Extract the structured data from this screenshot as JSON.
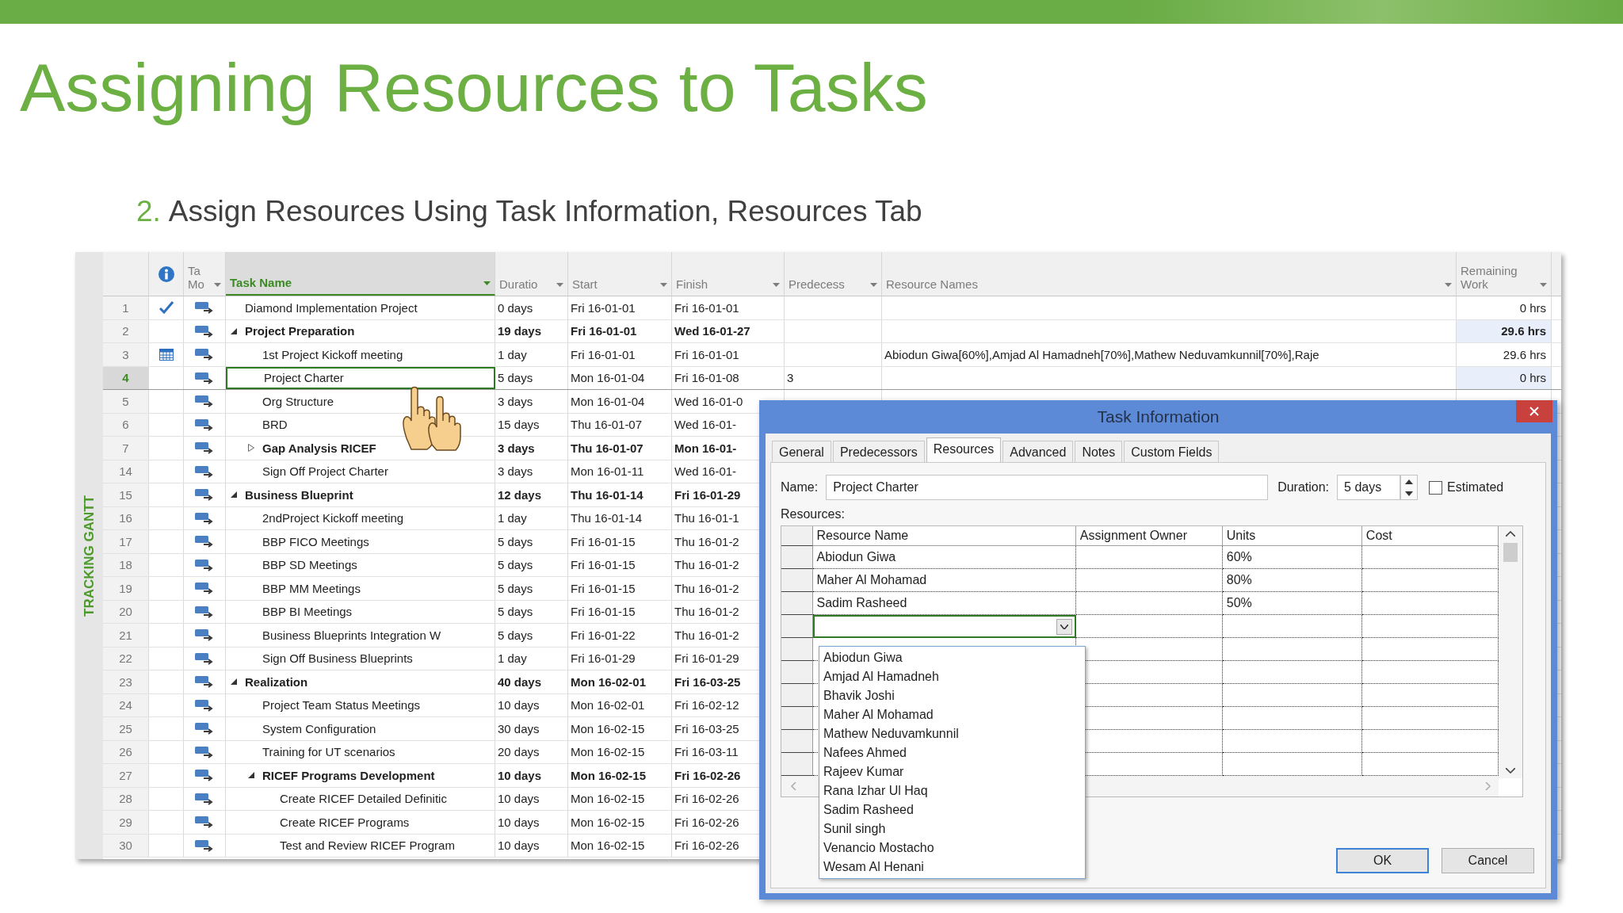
{
  "slide": {
    "title": "Assigning Resources to Tasks",
    "step_number": "2.",
    "subtitle": "Assign Resources Using Task Information, Resources Tab",
    "side_label": "TRACKING GANTT"
  },
  "table": {
    "columns": [
      {
        "kind": "info",
        "selected": false
      },
      {
        "kind": "text",
        "label": "Ta Mo",
        "selected": false
      },
      {
        "kind": "text",
        "label": "Task Name",
        "selected": true
      },
      {
        "kind": "text",
        "label": "Duratio",
        "selected": false
      },
      {
        "kind": "text",
        "label": "Start",
        "selected": false
      },
      {
        "kind": "text",
        "label": "Finish",
        "selected": false
      },
      {
        "kind": "text",
        "label": "Predecess",
        "selected": false
      },
      {
        "kind": "text",
        "label": "Resource Names",
        "selected": false
      },
      {
        "kind": "text",
        "label": "Remaining Work",
        "selected": false
      }
    ],
    "rows": [
      {
        "id": "1",
        "indicator": {
          "kind": "checkmark"
        },
        "name": "Diamond Implementation Project",
        "summary": false,
        "selected": false,
        "duration": "0 days",
        "start": "Fri 16-01-01",
        "finish": "Fri 16-01-01",
        "remaining_work": "0 hrs"
      },
      {
        "id": "2",
        "name": "Project Preparation",
        "summary": true,
        "expanded": true,
        "selected": false,
        "duration": "19 days",
        "start": "Fri 16-01-01",
        "finish": "Wed 16-01-27",
        "remaining_work": "29.6 hrs",
        "children": [
          {
            "id": "3",
            "indicator": {
              "kind": "calendar"
            },
            "name": "1st Project Kickoff meeting",
            "summary": false,
            "selected": false,
            "duration": "1 day",
            "start": "Fri 16-01-01",
            "finish": "Fri 16-01-01",
            "resource_names": "Abiodun Giwa[60%],Amjad Al Hamadneh[70%],Mathew Neduvamkunnil[70%],Raje",
            "remaining_work": "29.6 hrs"
          },
          {
            "id": "4",
            "name": "Project Charter",
            "summary": false,
            "selected": true,
            "duration": "5 days",
            "start": "Mon 16-01-04",
            "finish": "Fri 16-01-08",
            "predecessors": "3",
            "remaining_work": "0 hrs"
          },
          {
            "id": "5",
            "name": "Org Structure",
            "summary": false,
            "selected": false,
            "duration": "3 days",
            "start": "Mon 16-01-04",
            "finish": "Wed 16-01-0"
          },
          {
            "id": "6",
            "name": "BRD",
            "summary": false,
            "selected": false,
            "duration": "15 days",
            "start": "Thu 16-01-07",
            "finish": "Wed 16-01-"
          },
          {
            "id": "7",
            "name": "Gap Analysis RICEF",
            "summary": true,
            "expanded": false,
            "selected": false,
            "duration": "3 days",
            "start": "Thu 16-01-07",
            "finish": "Mon 16-01-"
          },
          {
            "id": "14",
            "name": "Sign Off  Project Charter",
            "summary": false,
            "selected": false,
            "duration": "3 days",
            "start": "Mon 16-01-11",
            "finish": "Wed 16-01-"
          }
        ]
      },
      {
        "id": "15",
        "name": "Business Blueprint",
        "summary": true,
        "expanded": true,
        "selected": false,
        "duration": "12 days",
        "start": "Thu 16-01-14",
        "finish": "Fri 16-01-29",
        "children": [
          {
            "id": "16",
            "name": "2ndProject Kickoff meeting",
            "summary": false,
            "selected": false,
            "duration": "1 day",
            "start": "Thu 16-01-14",
            "finish": "Thu 16-01-1"
          },
          {
            "id": "17",
            "name": "BBP FICO Meetings",
            "summary": false,
            "selected": false,
            "duration": "5 days",
            "start": "Fri 16-01-15",
            "finish": "Thu 16-01-2"
          },
          {
            "id": "18",
            "name": "BBP SD Meetings",
            "summary": false,
            "selected": false,
            "duration": "5 days",
            "start": "Fri 16-01-15",
            "finish": "Thu 16-01-2"
          },
          {
            "id": "19",
            "name": "BBP MM Meetings",
            "summary": false,
            "selected": false,
            "duration": "5 days",
            "start": "Fri 16-01-15",
            "finish": "Thu 16-01-2"
          },
          {
            "id": "20",
            "name": "BBP BI Meetings",
            "summary": false,
            "selected": false,
            "duration": "5 days",
            "start": "Fri 16-01-15",
            "finish": "Thu 16-01-2"
          },
          {
            "id": "21",
            "name": "Business Blueprints Integration W",
            "summary": false,
            "selected": false,
            "duration": "5 days",
            "start": "Fri 16-01-22",
            "finish": "Thu 16-01-2"
          },
          {
            "id": "22",
            "name": "Sign Off  Business Blueprints",
            "summary": false,
            "selected": false,
            "duration": "1 day",
            "start": "Fri 16-01-29",
            "finish": "Fri 16-01-29"
          }
        ]
      },
      {
        "id": "23",
        "name": "Realization",
        "summary": true,
        "expanded": true,
        "selected": false,
        "duration": "40 days",
        "start": "Mon 16-02-01",
        "finish": "Fri 16-03-25",
        "children": [
          {
            "id": "24",
            "name": "Project Team Status Meetings",
            "summary": false,
            "selected": false,
            "duration": "10 days",
            "start": "Mon 16-02-01",
            "finish": "Fri 16-02-12"
          },
          {
            "id": "25",
            "name": "System Configuration",
            "summary": false,
            "selected": false,
            "duration": "30 days",
            "start": "Mon 16-02-15",
            "finish": "Fri 16-03-25"
          },
          {
            "id": "26",
            "name": "Training for UT scenarios",
            "summary": false,
            "selected": false,
            "duration": "20 days",
            "start": "Mon 16-02-15",
            "finish": "Fri 16-03-11"
          },
          {
            "id": "27",
            "name": "RICEF Programs Development",
            "summary": true,
            "expanded": true,
            "selected": false,
            "duration": "10 days",
            "start": "Mon 16-02-15",
            "finish": "Fri 16-02-26",
            "children": [
              {
                "id": "28",
                "name": "Create RICEF Detailed Definitic",
                "summary": false,
                "selected": false,
                "duration": "10 days",
                "start": "Mon 16-02-15",
                "finish": "Fri 16-02-26"
              },
              {
                "id": "29",
                "name": "Create RICEF Programs",
                "summary": false,
                "selected": false,
                "duration": "10 days",
                "start": "Mon 16-02-15",
                "finish": "Fri 16-02-26"
              },
              {
                "id": "30",
                "name": "Test and Review RICEF Program",
                "summary": false,
                "selected": false,
                "duration": "10 days",
                "start": "Mon 16-02-15",
                "finish": "Fri 16-02-26"
              }
            ]
          }
        ]
      }
    ]
  },
  "dialog": {
    "title": "Task Information",
    "tabs": [
      {
        "label": "General",
        "selected": false
      },
      {
        "label": "Predecessors",
        "selected": false
      },
      {
        "label": "Resources",
        "selected": true
      },
      {
        "label": "Advanced",
        "selected": false
      },
      {
        "label": "Notes",
        "selected": false
      },
      {
        "label": "Custom Fields",
        "selected": false
      }
    ],
    "name": {
      "label": "Name:",
      "value": "Project Charter"
    },
    "duration": {
      "label": "Duration:",
      "value": "5 days"
    },
    "estimated": {
      "label": "Estimated",
      "checked": false
    },
    "resources_label": "Resources:",
    "grid": {
      "columns": [
        "Resource Name",
        "Assignment Owner",
        "Units",
        "Cost"
      ],
      "rows": [
        {
          "resource_name": "Abiodun Giwa",
          "units": "60%"
        },
        {
          "resource_name": "Maher Al Mohamad",
          "units": "80%"
        },
        {
          "resource_name": "Sadim Rasheed",
          "units": "50%"
        }
      ]
    },
    "dropdown": {
      "items": [
        "Abiodun Giwa",
        "Amjad Al Hamadneh",
        "Bhavik Joshi",
        "Maher Al Mohamad",
        "Mathew Neduvamkunnil",
        "Nafees Ahmed",
        "Rajeev Kumar",
        "Rana Izhar Ul Haq",
        "Sadim Rasheed",
        "Sunil singh",
        "Venancio Mostacho",
        "Wesam Al Henani"
      ]
    },
    "buttons": [
      {
        "label": "OK",
        "default": true
      },
      {
        "label": "Cancel",
        "default": false
      }
    ]
  }
}
